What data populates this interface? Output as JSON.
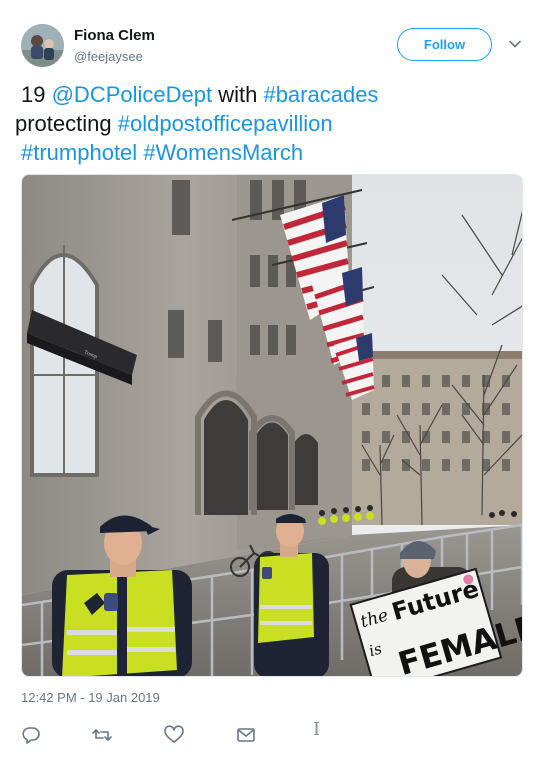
{
  "user": {
    "name": "Fiona Clem",
    "handle": "@feejaysee",
    "avatar_icon": "profile-photo"
  },
  "follow_label": "Follow",
  "tweet": {
    "parts": [
      {
        "text": "19 ",
        "link": false
      },
      {
        "text": "@DCPoliceDept",
        "link": true
      },
      {
        "text": " with ",
        "link": false
      },
      {
        "text": "#baracades",
        "link": true
      },
      {
        "text": " protecting ",
        "link": false
      },
      {
        "text": "#oldpostofficepavillion",
        "link": true
      },
      {
        "text": " ",
        "link": false
      },
      {
        "text": "#trumphotel",
        "link": true
      },
      {
        "text": " ",
        "link": false
      },
      {
        "text": "#WomensMarch",
        "link": true
      }
    ]
  },
  "photo": {
    "sign_lines": [
      "the",
      "Future",
      "is",
      "FEMALE"
    ],
    "awning_text": "Trump"
  },
  "timestamp": "12:42 PM - 19 Jan 2019",
  "actions": [
    "reply-icon",
    "retweet-icon",
    "like-icon",
    "message-icon"
  ],
  "colors": {
    "link": "#1b95e0",
    "follow_border": "#1da1f2",
    "secondary_text": "#657786",
    "vest": "#c8e021"
  }
}
